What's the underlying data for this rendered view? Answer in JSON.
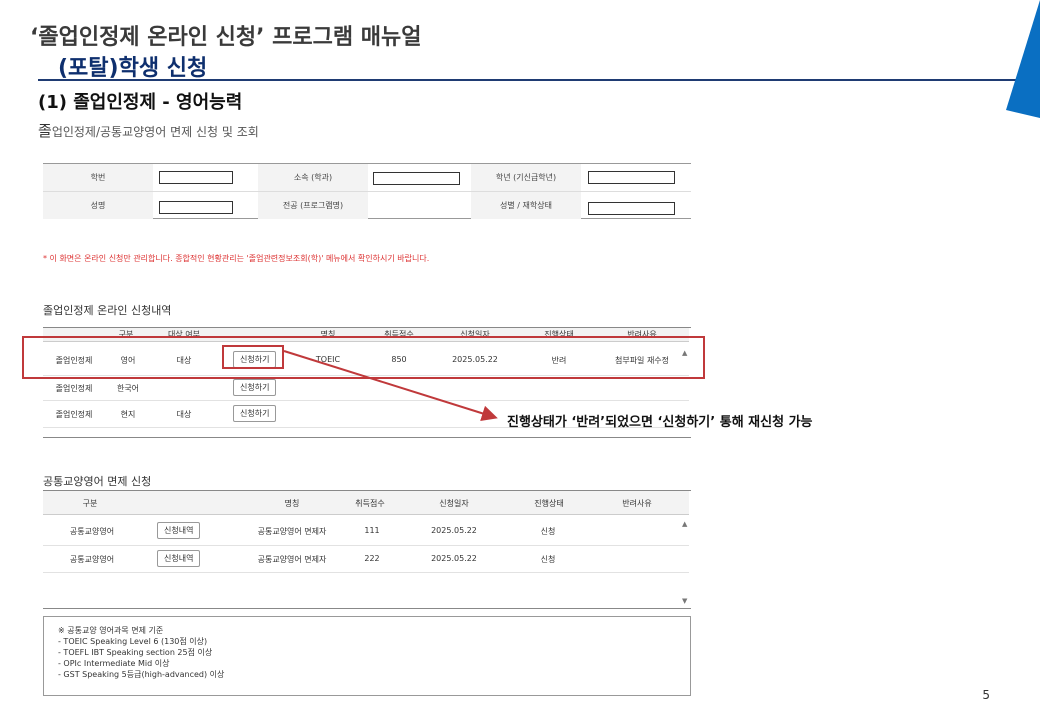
{
  "header": {
    "title_line1": "‘졸업인정제 온라인 신청’ 프로그램 매뉴얼",
    "title_line2": "(포탈)학생 신청",
    "section": "(1) 졸업인정제 - 영어능력",
    "subtitle_first": "졸",
    "subtitle_rest": "업인정제/공통교양영어 면제 신청 및 조회",
    "page_number": "5",
    "accent_color": "#0a6fc2"
  },
  "info": {
    "labels": [
      "학번",
      "소속 (학과)",
      "학년 (기신급학년)",
      "성명",
      "전공 (프로그램명)",
      "성별 / 재학상태"
    ]
  },
  "notice": "* 이 화면은 온라인 신청만 관리합니다. 종합적인 현황관리는 '졸업관련정보조회(학)' 메뉴에서 확인하시기 바랍니다.",
  "grad": {
    "caption": "졸업인정제 온라인 신청내역",
    "headers": [
      "구분",
      "대상 여부",
      "명칭",
      "취득점수",
      "신청일자",
      "진행상태",
      "반려사유"
    ],
    "rows": [
      {
        "type": "졸업인정제",
        "category": "영어",
        "target": "대상",
        "button": "신청하기",
        "name": "TOEIC",
        "score": "850",
        "date": "2025.05.22",
        "status": "반려",
        "reason": "첨부파일 재수정"
      },
      {
        "type": "졸업인정제",
        "category": "한국어",
        "target": "",
        "button": "신청하기",
        "name": "",
        "score": "",
        "date": "",
        "status": "",
        "reason": ""
      },
      {
        "type": "졸업인정제",
        "category": "현지",
        "target": "대상",
        "button": "신청하기",
        "name": "",
        "score": "",
        "date": "",
        "status": "",
        "reason": ""
      }
    ]
  },
  "callout": "진행상태가 ‘반려’되었으면 ‘신청하기’ 통해 재신청 가능",
  "common": {
    "caption": "공통교양영어 면제 신청",
    "headers": [
      "구분",
      "명칭",
      "취득점수",
      "신청일자",
      "진행상태",
      "반려사유"
    ],
    "rows": [
      {
        "type": "공통교양영어",
        "button": "신청내역",
        "name": "공통교양영어 면제자",
        "score": "111",
        "date": "2025.05.22",
        "status": "신청"
      },
      {
        "type": "공통교양영어",
        "button": "신청내역",
        "name": "공통교양영어 면제자",
        "score": "222",
        "date": "2025.05.22",
        "status": "신청"
      }
    ]
  },
  "criteria": {
    "title": "※ 공통교양 영어과목 면제 기준",
    "items": [
      "- TOEIC Speaking Level 6 (130점 이상)",
      "- TOEFL IBT Speaking section 25점 이상",
      "- OPIc Intermediate Mid 이상",
      "- GST Speaking 5등급(high-advanced) 이상"
    ]
  }
}
